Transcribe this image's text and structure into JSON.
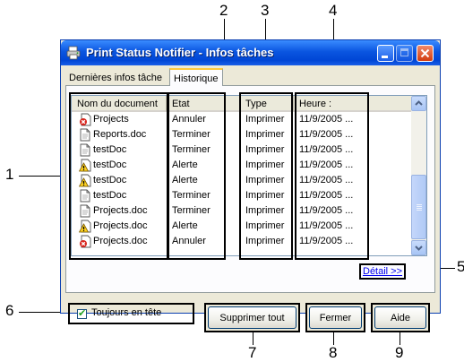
{
  "window": {
    "title": "Print Status Notifier - Infos tâches",
    "title_icon": "printer-icon"
  },
  "tabs": [
    {
      "label": "Dernières infos tâche",
      "active": false
    },
    {
      "label": "Historique",
      "active": true
    }
  ],
  "table": {
    "columns": [
      "Nom du document",
      "Etat",
      "Type",
      "Heure :"
    ],
    "rows": [
      {
        "icon": "error-doc-icon",
        "name": "Projects",
        "state": "Annuler",
        "type": "Imprimer",
        "time": "11/9/2005 ..."
      },
      {
        "icon": "document-icon",
        "name": "Reports.doc",
        "state": "Terminer",
        "type": "Imprimer",
        "time": "11/9/2005 ..."
      },
      {
        "icon": "document-icon",
        "name": "testDoc",
        "state": "Terminer",
        "type": "Imprimer",
        "time": "11/9/2005 ..."
      },
      {
        "icon": "warning-doc-icon",
        "name": "testDoc",
        "state": "Alerte",
        "type": "Imprimer",
        "time": "11/9/2005 ..."
      },
      {
        "icon": "warning-doc-icon",
        "name": "testDoc",
        "state": "Alerte",
        "type": "Imprimer",
        "time": "11/9/2005 ..."
      },
      {
        "icon": "document-icon",
        "name": "testDoc",
        "state": "Terminer",
        "type": "Imprimer",
        "time": "11/9/2005 ..."
      },
      {
        "icon": "document-icon",
        "name": "Projects.doc",
        "state": "Terminer",
        "type": "Imprimer",
        "time": "11/9/2005 ..."
      },
      {
        "icon": "warning-doc-icon",
        "name": "Projects.doc",
        "state": "Alerte",
        "type": "Imprimer",
        "time": "11/9/2005 ..."
      },
      {
        "icon": "error-doc-icon",
        "name": "Projects.doc",
        "state": "Annuler",
        "type": "Imprimer",
        "time": "11/9/2005 ..."
      }
    ]
  },
  "detail_link": "Détail >>",
  "checkbox": {
    "label": "Toujours en tête",
    "checked": true
  },
  "buttons": {
    "delete_all": "Supprimer tout",
    "close": "Fermer",
    "help": "Aide"
  },
  "callouts": [
    "1",
    "2",
    "3",
    "4",
    "5",
    "6",
    "7",
    "8",
    "9"
  ],
  "colors": {
    "titlebar": "#0a55e0",
    "window_bg": "#ece9d8",
    "link": "#0000ee",
    "close_button": "#d23c0e"
  }
}
